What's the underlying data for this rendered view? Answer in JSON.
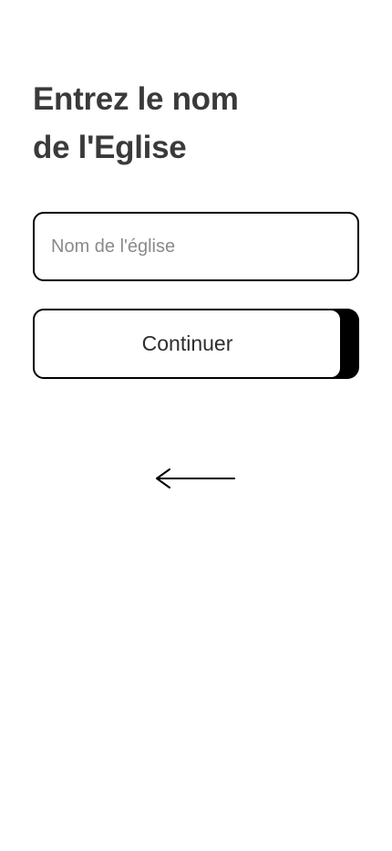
{
  "title": {
    "line1": "Entrez le nom",
    "line2": "de l'Eglise"
  },
  "church_input": {
    "value": "",
    "placeholder": "Nom de l'église"
  },
  "continue_button": {
    "label": "Continuer"
  },
  "back": {
    "icon": "arrow-left-icon"
  },
  "colors": {
    "background": "#ffffff",
    "text": "#3a3a3a",
    "border": "#000000",
    "placeholder": "#8a8a8a"
  }
}
